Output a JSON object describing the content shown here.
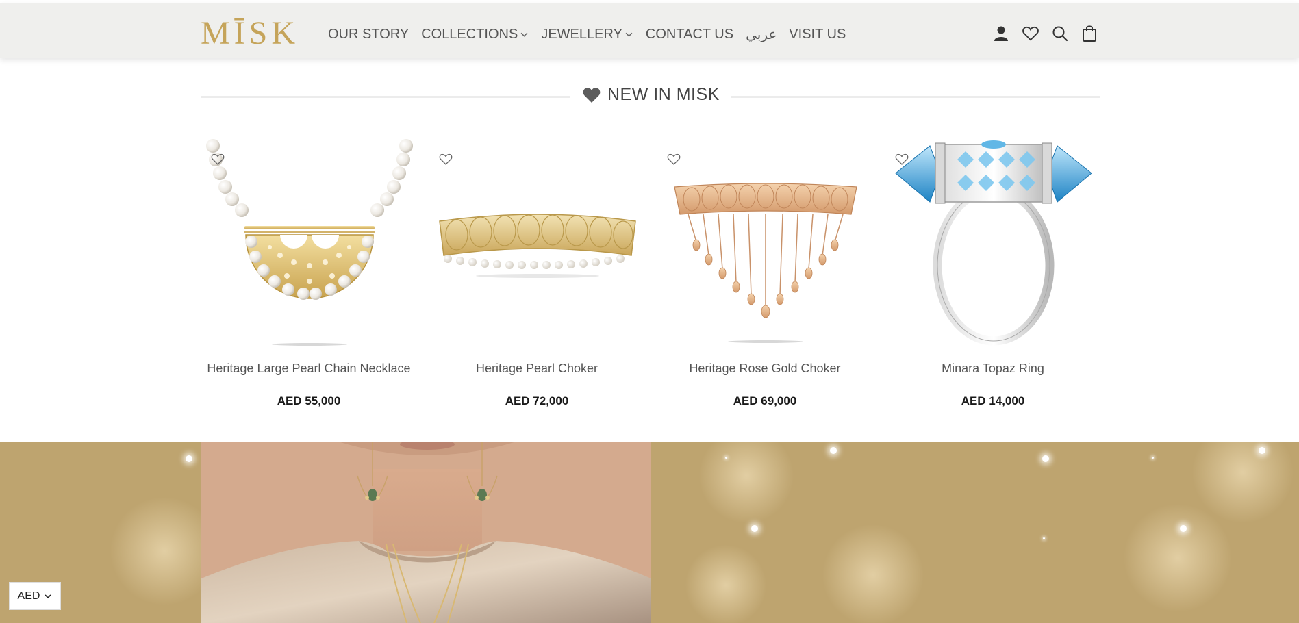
{
  "header": {
    "logo_text": "MĪSK",
    "nav": [
      {
        "label": "OUR STORY",
        "has_dropdown": false
      },
      {
        "label": "COLLECTIONS",
        "has_dropdown": true
      },
      {
        "label": "JEWELLERY",
        "has_dropdown": true
      },
      {
        "label": "CONTACT US",
        "has_dropdown": false
      },
      {
        "label": "عربي",
        "has_dropdown": false
      },
      {
        "label": "VISIT US",
        "has_dropdown": false
      }
    ],
    "icons": [
      "account-icon",
      "wishlist-icon",
      "search-icon",
      "cart-icon"
    ]
  },
  "section": {
    "title": "NEW IN MISK",
    "icon": "heart-icon"
  },
  "products": [
    {
      "name": "Heritage Large Pearl Chain Necklace",
      "price": "AED 55,000"
    },
    {
      "name": "Heritage Pearl Choker",
      "price": "AED 72,000"
    },
    {
      "name": "Heritage Rose Gold Choker",
      "price": "AED 69,000"
    },
    {
      "name": "Minara Topaz Ring",
      "price": "AED 14,000"
    }
  ],
  "currency": {
    "selected": "AED"
  },
  "colors": {
    "brand_gold": "#c5a45a",
    "header_bg": "#efefed",
    "banner_bg": "#bea46f"
  }
}
